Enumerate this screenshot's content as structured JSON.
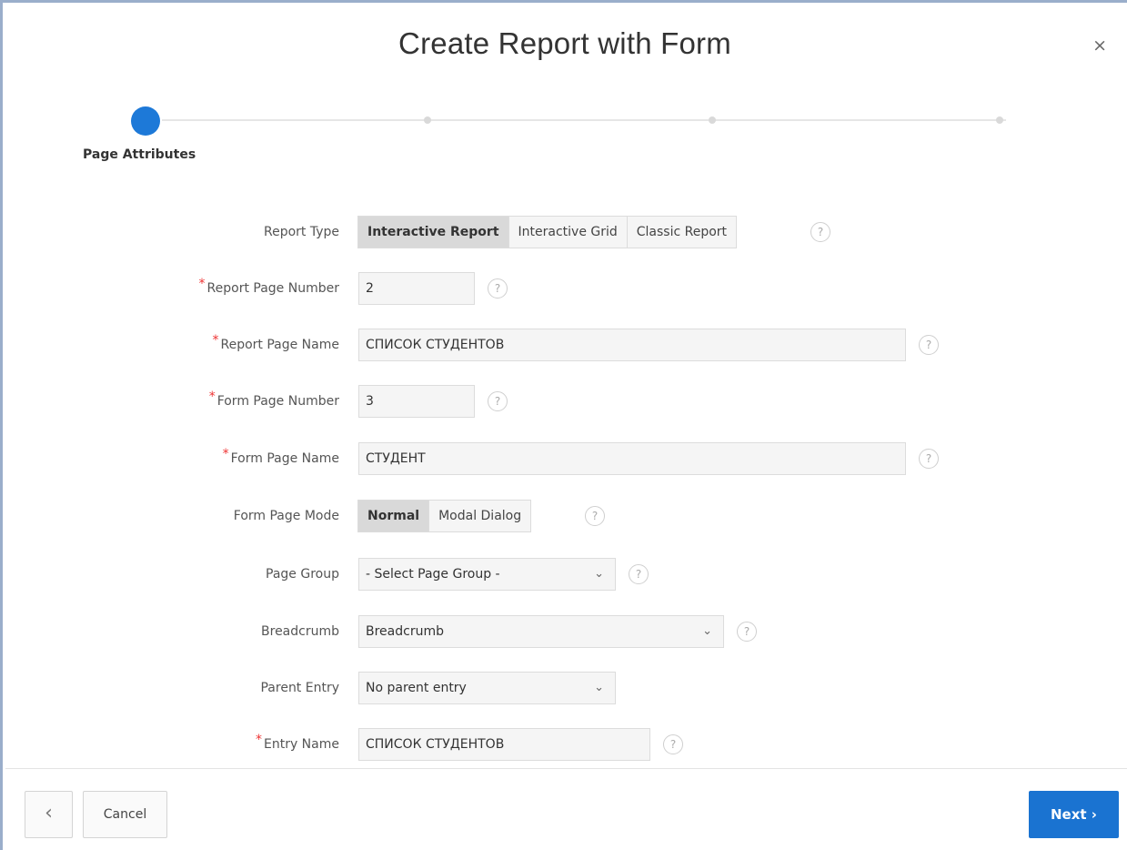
{
  "dialog": {
    "title": "Create Report with Form",
    "close_label": "×"
  },
  "wizard": {
    "current_step_label": "Page Attributes",
    "total_steps": 4,
    "current_step": 1
  },
  "form": {
    "report_type": {
      "label": "Report Type",
      "options": [
        "Interactive Report",
        "Interactive Grid",
        "Classic Report"
      ],
      "selected": "Interactive Report"
    },
    "report_page_number": {
      "label": "Report Page Number",
      "value": "2",
      "required": true
    },
    "report_page_name": {
      "label": "Report Page Name",
      "value": "СПИСОК СТУДЕНТОВ",
      "required": true
    },
    "form_page_number": {
      "label": "Form Page Number",
      "value": "3",
      "required": true
    },
    "form_page_name": {
      "label": "Form Page Name",
      "value": "СТУДЕНТ",
      "required": true
    },
    "form_page_mode": {
      "label": "Form Page Mode",
      "options": [
        "Normal",
        "Modal Dialog"
      ],
      "selected": "Normal"
    },
    "page_group": {
      "label": "Page Group",
      "value": "- Select Page Group -"
    },
    "breadcrumb": {
      "label": "Breadcrumb",
      "value": "Breadcrumb"
    },
    "parent_entry": {
      "label": "Parent Entry",
      "value": "No parent entry"
    },
    "entry_name": {
      "label": "Entry Name",
      "value": "СПИСОК СТУДЕНТОВ",
      "required": true
    }
  },
  "help_glyph": "?",
  "required_glyph": "*",
  "chevron_glyph": "⌄",
  "footer": {
    "back_glyph": "‹",
    "cancel_label": "Cancel",
    "next_label": "Next ›"
  },
  "colors": {
    "accent": "#1a73d1",
    "required": "#e33333"
  }
}
